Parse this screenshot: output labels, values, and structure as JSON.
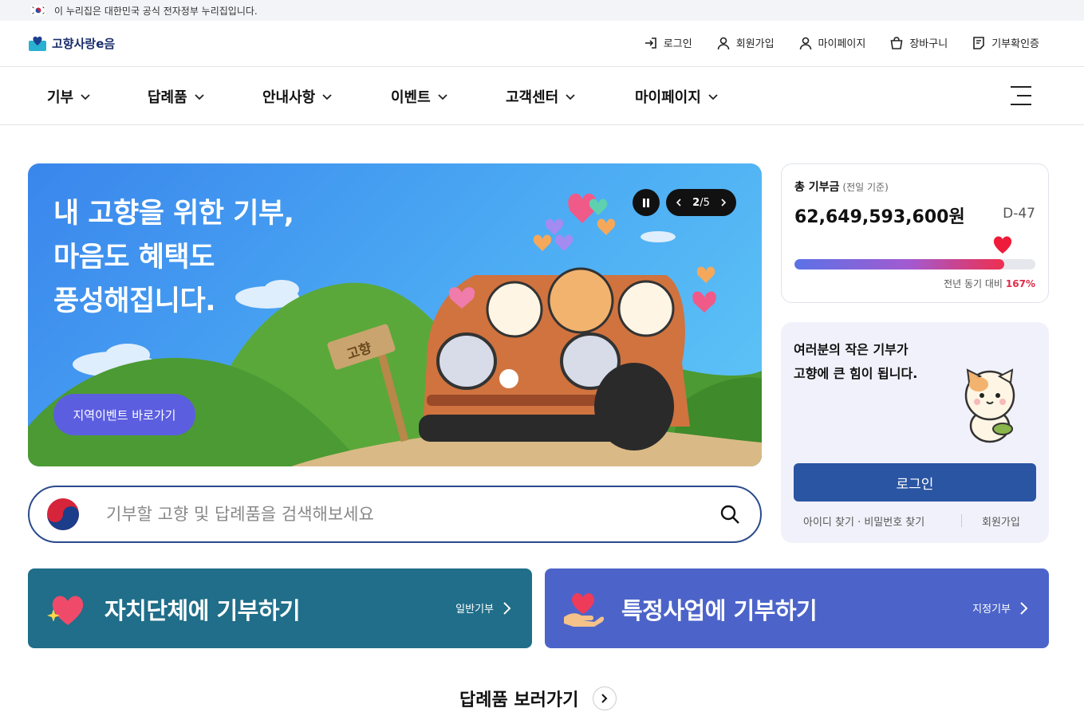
{
  "gov_bar": {
    "text": "이 누리집은 대한민국 공식 전자정부 누리집입니다."
  },
  "header": {
    "logo": "고향사랑e음",
    "util": [
      {
        "label": "로그인",
        "icon": "login-icon"
      },
      {
        "label": "회원가입",
        "icon": "user-plus-icon"
      },
      {
        "label": "마이페이지",
        "icon": "user-icon"
      },
      {
        "label": "장바구니",
        "icon": "cart-icon"
      },
      {
        "label": "기부확인증",
        "icon": "certificate-icon"
      }
    ]
  },
  "gnb": {
    "menus": [
      "기부",
      "답례품",
      "안내사항",
      "이벤트",
      "고객센터",
      "마이페이지"
    ]
  },
  "banner": {
    "headline": "내 고향을 위한 기부,\n마음도 혜택도\n풍성해집니다.",
    "cta": "지역이벤트 바로가기",
    "sign": "고향",
    "page_current": "2",
    "page_total": "/5"
  },
  "search": {
    "placeholder": "기부할 고향 및 답례품을 검색해보세요"
  },
  "stats": {
    "title": "총 기부금",
    "basis": "(전일 기준)",
    "amount": "62,649,593,600원",
    "dday": "D-47",
    "progress_fraction": 0.87,
    "compare_label": "전년 동기 대비",
    "compare_value": "167%"
  },
  "login": {
    "message": "여러분의 작은 기부가\n고향에 큰 힘이 됩니다.",
    "button": "로그인",
    "find": "아이디 찾기 · 비밀번호 찾기",
    "signup": "회원가입"
  },
  "cards": [
    {
      "title": "자치단체에 기부하기",
      "sub": "일반기부",
      "color": "#206e89"
    },
    {
      "title": "특정사업에 기부하기",
      "sub": "지정기부",
      "color": "#4c64c9"
    }
  ],
  "more": {
    "label": "답례품 보러가기"
  }
}
